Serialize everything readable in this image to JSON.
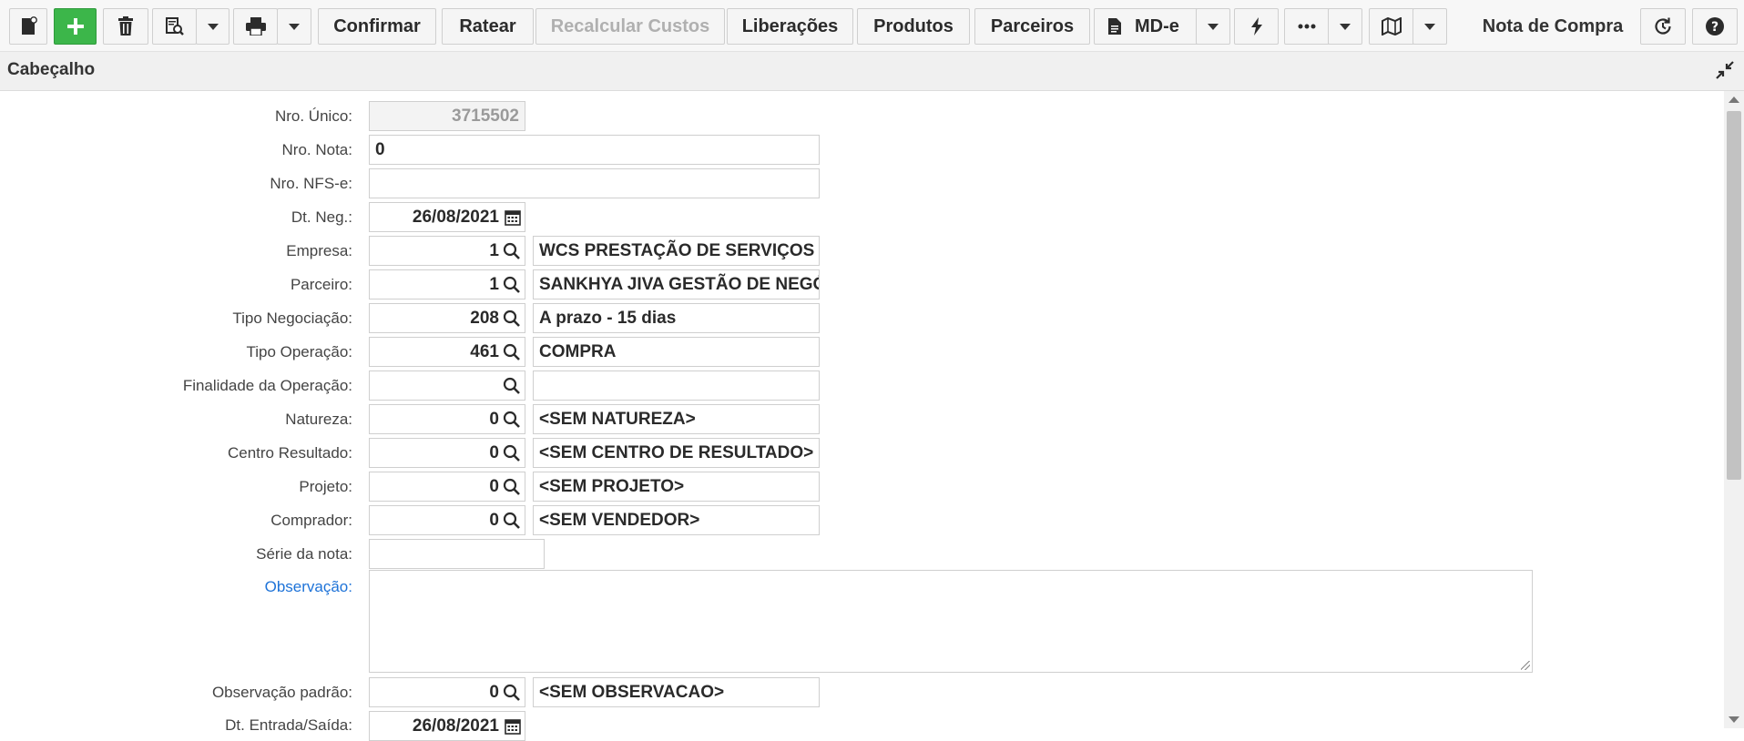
{
  "toolbar": {
    "confirmar": "Confirmar",
    "ratear": "Ratear",
    "recalcular": "Recalcular Custos",
    "liberacoes": "Liberações",
    "produtos": "Produtos",
    "parceiros": "Parceiros",
    "mde": "MD-e",
    "title": "Nota de Compra"
  },
  "section": {
    "label": "Cabeçalho"
  },
  "form": {
    "nro_unico": {
      "label": "Nro. Único:",
      "value": "3715502"
    },
    "nro_nota": {
      "label": "Nro. Nota:",
      "value": "0"
    },
    "nro_nfse": {
      "label": "Nro. NFS-e:",
      "value": ""
    },
    "dt_neg": {
      "label": "Dt. Neg.:",
      "value": "26/08/2021"
    },
    "empresa": {
      "label": "Empresa:",
      "code": "1",
      "desc": "WCS PRESTAÇÃO DE SERVIÇOS"
    },
    "parceiro": {
      "label": "Parceiro:",
      "code": "1",
      "desc": "SANKHYA JIVA GESTÃO DE NEGÓCIOS"
    },
    "tipo_negociacao": {
      "label": "Tipo Negociação:",
      "code": "208",
      "desc": "A prazo - 15 dias"
    },
    "tipo_operacao": {
      "label": "Tipo Operação:",
      "code": "461",
      "desc": "COMPRA"
    },
    "finalidade": {
      "label": "Finalidade da Operação:",
      "code": "",
      "desc": ""
    },
    "natureza": {
      "label": "Natureza:",
      "code": "0",
      "desc": "<SEM NATUREZA>"
    },
    "centro_resultado": {
      "label": "Centro Resultado:",
      "code": "0",
      "desc": "<SEM CENTRO DE RESULTADO>"
    },
    "projeto": {
      "label": "Projeto:",
      "code": "0",
      "desc": "<SEM PROJETO>"
    },
    "comprador": {
      "label": "Comprador:",
      "code": "0",
      "desc": "<SEM VENDEDOR>"
    },
    "serie": {
      "label": "Série da nota:",
      "value": ""
    },
    "observacao": {
      "label": "Observação:",
      "value": ""
    },
    "obs_padrao": {
      "label": "Observação padrão:",
      "code": "0",
      "desc": "<SEM OBSERVACAO>"
    },
    "dt_entrada": {
      "label": "Dt. Entrada/Saída:",
      "value": "26/08/2021"
    }
  },
  "icons": {
    "new_doc": "new-document-icon",
    "add": "plus-icon",
    "delete": "trash-icon",
    "preview": "document-search-icon",
    "print": "printer-icon",
    "lightning": "lightning-icon",
    "more": "ellipsis-icon",
    "map": "map-icon",
    "refresh": "refresh-icon",
    "help": "help-icon",
    "search": "search-icon",
    "calendar": "calendar-icon",
    "collapse": "collapse-icon"
  },
  "colors": {
    "add_button": "#3cb64a",
    "link_label": "#1e73d8"
  }
}
